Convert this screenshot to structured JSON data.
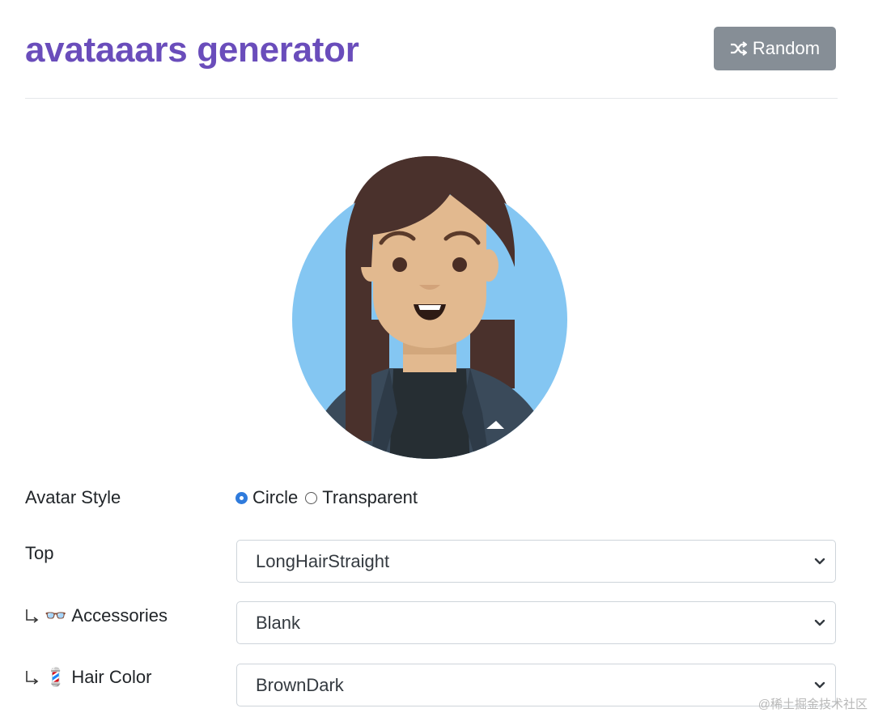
{
  "header": {
    "title": "avataaars generator",
    "random_button": {
      "label": "Random",
      "icon": "shuffle-icon"
    }
  },
  "avatar": {
    "style": "Circle",
    "colors": {
      "background": "#84c6f2",
      "skin": "#e2b98f",
      "hair": "#4a312c",
      "jacket": "#3a4a5a",
      "shirt": "#262e33"
    }
  },
  "form": {
    "avatar_style": {
      "label": "Avatar Style",
      "options": [
        "Circle",
        "Transparent"
      ],
      "selected": "Circle"
    },
    "top": {
      "label": "Top",
      "value": "LongHairStraight"
    },
    "accessories": {
      "emoji": "👓",
      "label": "Accessories",
      "value": "Blank"
    },
    "hair_color": {
      "emoji": "💈",
      "label": "Hair Color",
      "value": "BrownDark"
    }
  },
  "watermark": "@稀土掘金技术社区",
  "theme": {
    "title_color": "#6a4dbb",
    "button_color": "#868e96",
    "radio_accent": "#2f7bdc"
  }
}
